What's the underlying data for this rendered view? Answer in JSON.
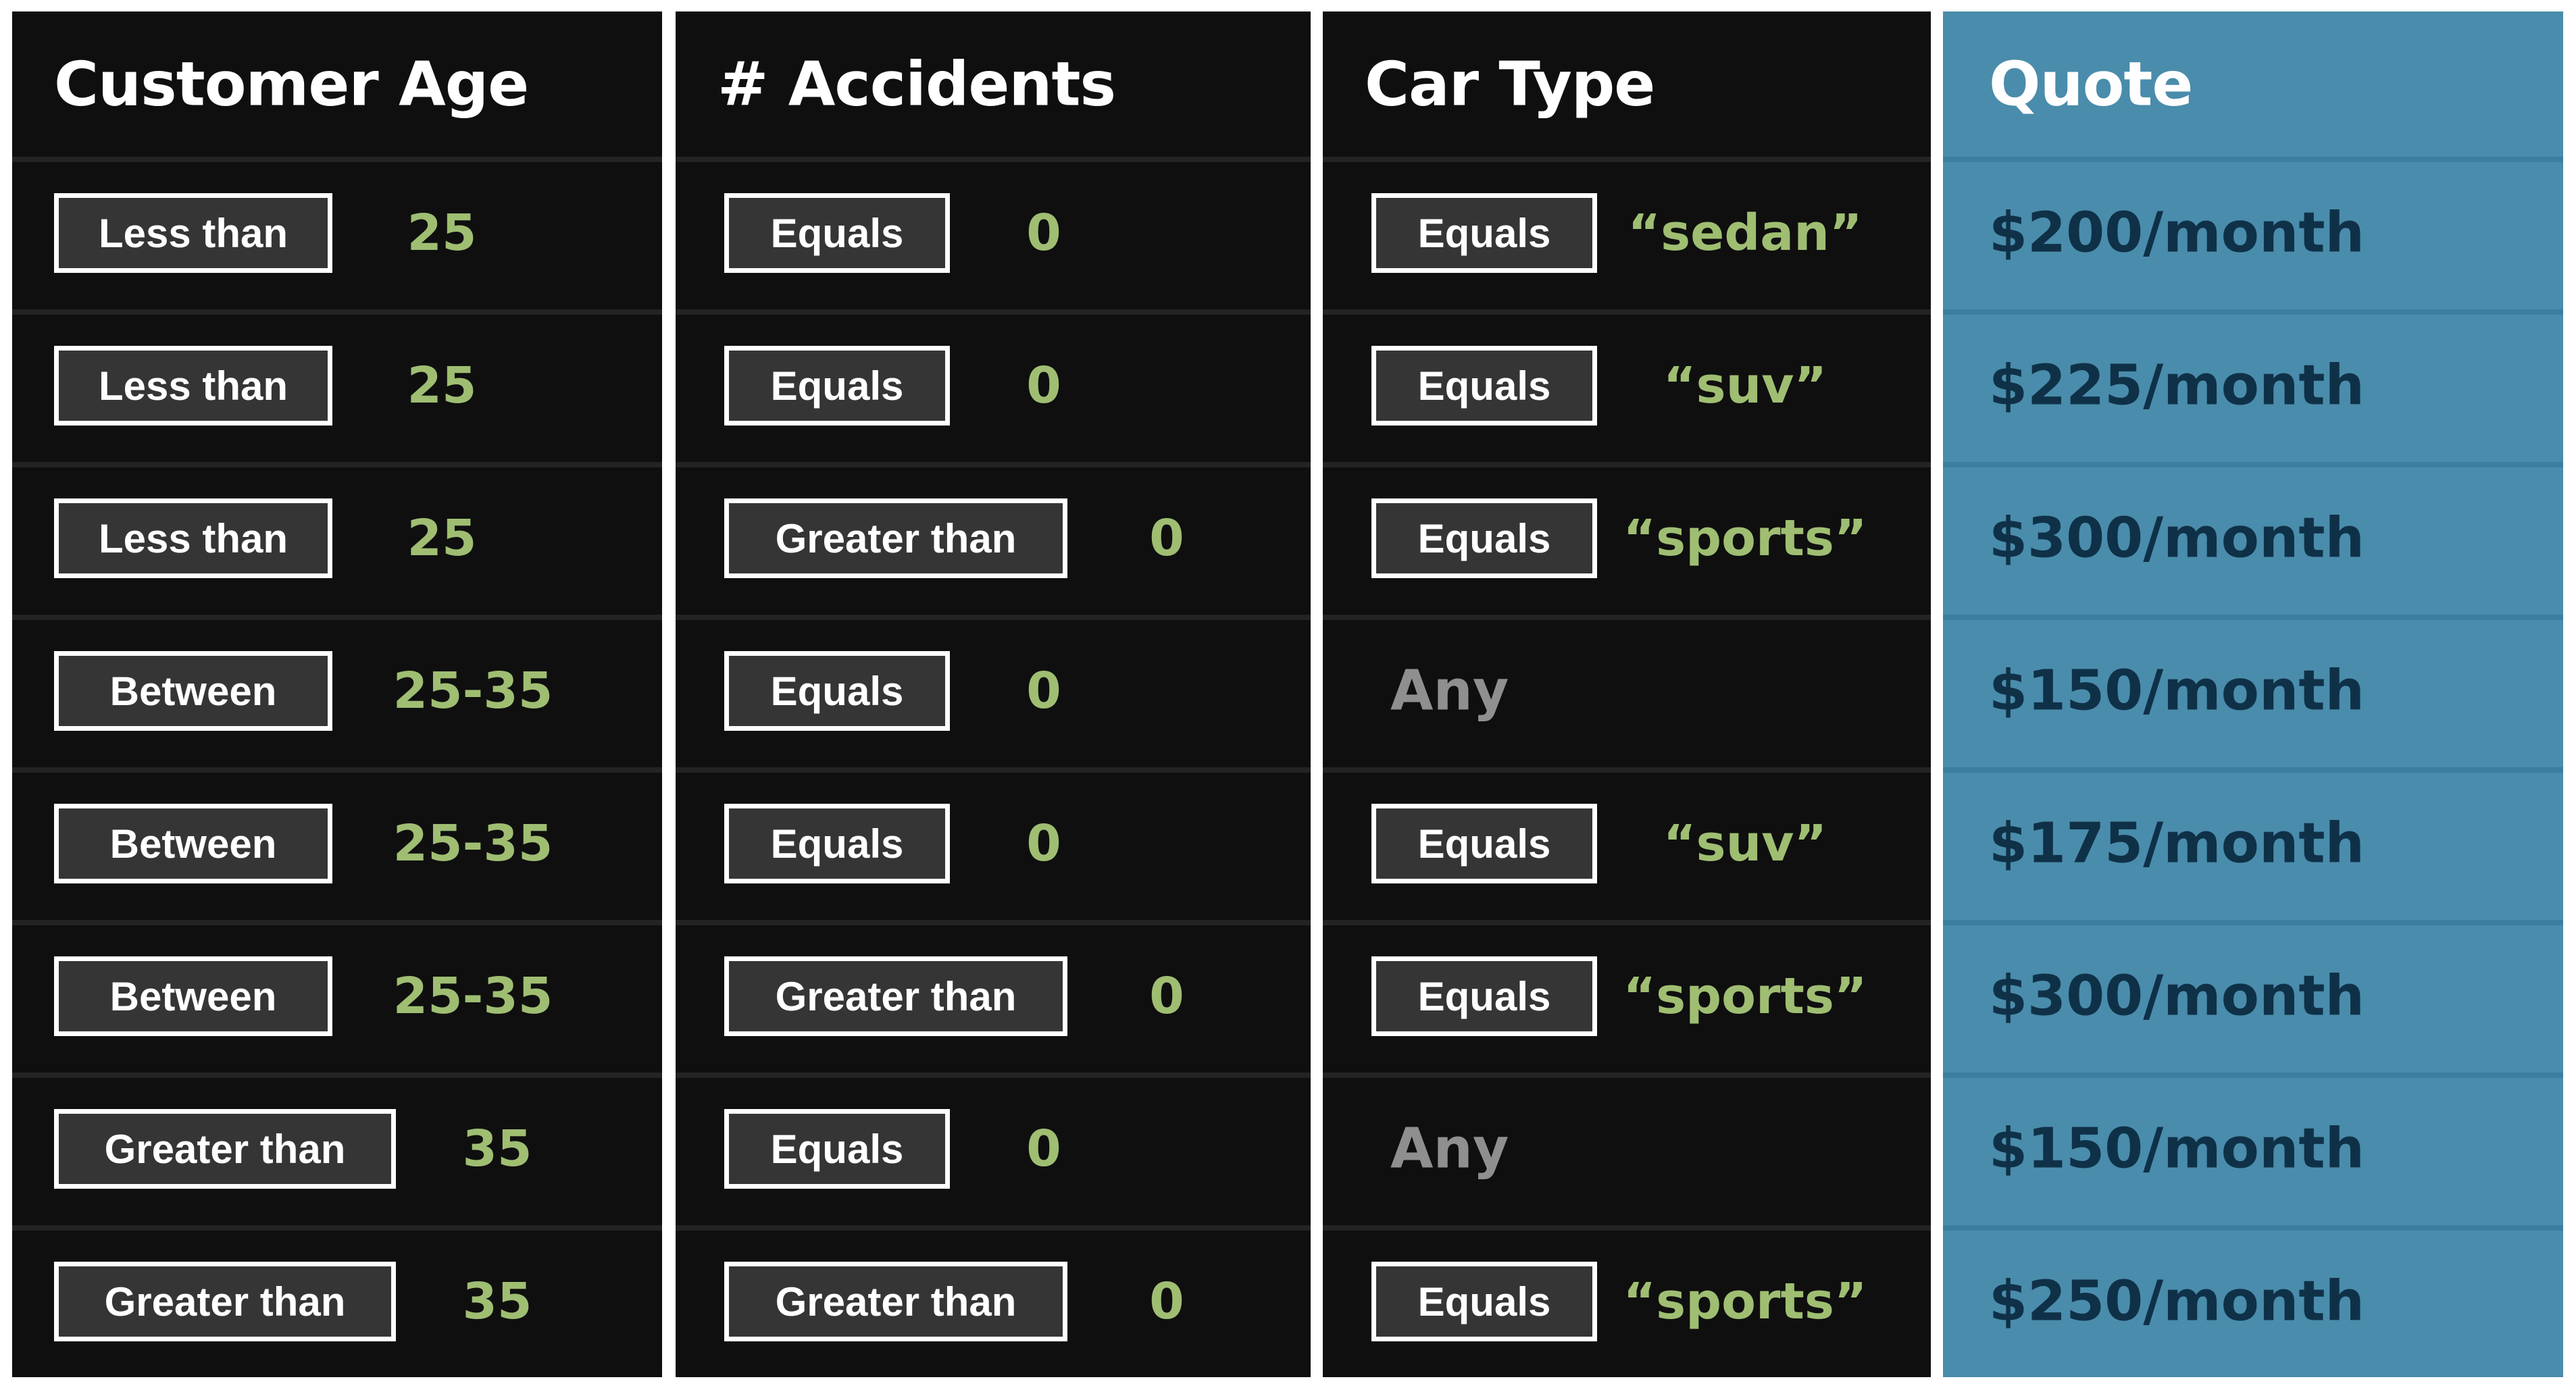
{
  "columns": {
    "age": {
      "title": "Customer Age"
    },
    "accidents": {
      "title": "# Accidents"
    },
    "car_type": {
      "title": "Car Type"
    },
    "quote": {
      "title": "Quote"
    }
  },
  "rows": [
    {
      "age_op": "Less than",
      "age_val": "25",
      "acc_op": "Equals",
      "acc_val": "0",
      "car_op": "Equals",
      "car_val": "“sedan”",
      "quote": "$200/month"
    },
    {
      "age_op": "Less than",
      "age_val": "25",
      "acc_op": "Equals",
      "acc_val": "0",
      "car_op": "Equals",
      "car_val": "“suv”",
      "quote": "$225/month"
    },
    {
      "age_op": "Less than",
      "age_val": "25",
      "acc_op": "Greater than",
      "acc_val": "0",
      "car_op": "Equals",
      "car_val": "“sports”",
      "quote": "$300/month"
    },
    {
      "age_op": "Between",
      "age_val": "25-35",
      "acc_op": "Equals",
      "acc_val": "0",
      "car_any": "Any",
      "quote": "$150/month"
    },
    {
      "age_op": "Between",
      "age_val": "25-35",
      "acc_op": "Equals",
      "acc_val": "0",
      "car_op": "Equals",
      "car_val": "“suv”",
      "quote": "$175/month"
    },
    {
      "age_op": "Between",
      "age_val": "25-35",
      "acc_op": "Greater than",
      "acc_val": "0",
      "car_op": "Equals",
      "car_val": "“sports”",
      "quote": "$300/month"
    },
    {
      "age_op": "Greater than",
      "age_val": "35",
      "acc_op": "Equals",
      "acc_val": "0",
      "car_any": "Any",
      "quote": "$150/month"
    },
    {
      "age_op": "Greater than",
      "age_val": "35",
      "acc_op": "Greater than",
      "acc_val": "0",
      "car_op": "Equals",
      "car_val": "“sports”",
      "quote": "$250/month"
    }
  ],
  "colors": {
    "panel_bg": "#0f0f0f",
    "quote_bg": "#4a8cab",
    "value_green": "#9fbe72",
    "any_gray": "#8f8f8f",
    "quote_text": "#0f3148",
    "box_bg": "#353535"
  }
}
